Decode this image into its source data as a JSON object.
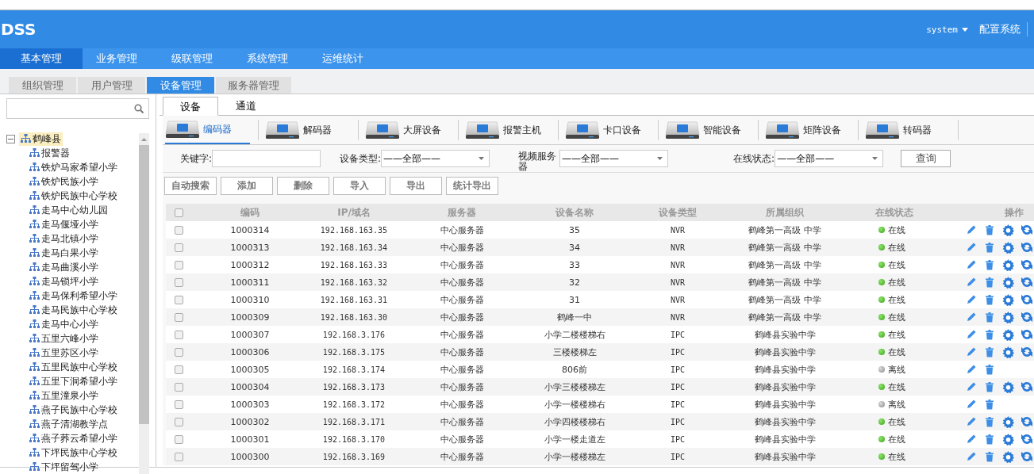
{
  "header": {
    "logo": "DSS",
    "user": "system",
    "config": "配置系统"
  },
  "nav": [
    {
      "label": "基本管理",
      "selected": true
    },
    {
      "label": "业务管理",
      "selected": false
    },
    {
      "label": "级联管理",
      "selected": false
    },
    {
      "label": "系统管理",
      "selected": false
    },
    {
      "label": "运维统计",
      "selected": false
    }
  ],
  "subtabs": [
    {
      "label": "组织管理",
      "selected": false
    },
    {
      "label": "用户管理",
      "selected": false
    },
    {
      "label": "设备管理",
      "selected": true
    },
    {
      "label": "服务器管理",
      "selected": false
    }
  ],
  "tree": {
    "label": "鹤峰县",
    "expanded": true,
    "selected": true,
    "children": [
      {
        "label": "报警器"
      },
      {
        "label": "铁炉马家希望小学"
      },
      {
        "label": "铁炉民族小学"
      },
      {
        "label": "铁炉民族中心学校"
      },
      {
        "label": "走马中心幼儿园"
      },
      {
        "label": "走马偃垭小学"
      },
      {
        "label": "走马北镇小学"
      },
      {
        "label": "走马白果小学"
      },
      {
        "label": "走马曲溪小学"
      },
      {
        "label": "走马锁坪小学"
      },
      {
        "label": "走马保利希望小学"
      },
      {
        "label": "走马民族中心学校"
      },
      {
        "label": "走马中心小学"
      },
      {
        "label": "五里六峰小学"
      },
      {
        "label": "五里苏区小学"
      },
      {
        "label": "五里民族中心学校"
      },
      {
        "label": "五里下洞希望小学"
      },
      {
        "label": "五里潼泉小学"
      },
      {
        "label": "燕子民族中心学校"
      },
      {
        "label": "燕子清湖教学点"
      },
      {
        "label": "燕子荞云希望小学"
      },
      {
        "label": "下坪民族中心学校"
      },
      {
        "label": "下坪留驾小学"
      }
    ]
  },
  "tabs": [
    {
      "label": "设备",
      "selected": true
    },
    {
      "label": "通道",
      "selected": false
    }
  ],
  "device_types": [
    {
      "label": "编码器",
      "selected": true
    },
    {
      "label": "解码器",
      "selected": false
    },
    {
      "label": "大屏设备",
      "selected": false
    },
    {
      "label": "报警主机",
      "selected": false
    },
    {
      "label": "卡口设备",
      "selected": false
    },
    {
      "label": "智能设备",
      "selected": false
    },
    {
      "label": "矩阵设备",
      "selected": false
    },
    {
      "label": "转码器",
      "selected": false
    }
  ],
  "filters": {
    "keyword_label": "关键字:",
    "type_label": "设备类型:",
    "type_value": "——全部——",
    "server_label": "视频服务器",
    "server_value": "——全部——",
    "status_label": "在线状态:",
    "status_value": "——全部——",
    "query": "查询"
  },
  "actions": [
    "自动搜索",
    "添加",
    "删除",
    "导入",
    "导出",
    "统计导出"
  ],
  "table": {
    "header_checked": false,
    "columns": [
      "编码",
      "IP/域名",
      "服务器",
      "设备名称",
      "设备类型",
      "所属组织",
      "在线状态",
      "操作"
    ],
    "rows": [
      {
        "code": "1000314",
        "ip": "192.168.163.35",
        "server": "中心服务器",
        "name": "35",
        "type": "NVR",
        "org": "鹤峰第一高级 中学",
        "status": "在线",
        "online": true,
        "checked": false
      },
      {
        "code": "1000313",
        "ip": "192.168.163.34",
        "server": "中心服务器",
        "name": "34",
        "type": "NVR",
        "org": "鹤峰第一高级 中学",
        "status": "在线",
        "online": true,
        "checked": false
      },
      {
        "code": "1000312",
        "ip": "192.168.163.33",
        "server": "中心服务器",
        "name": "33",
        "type": "NVR",
        "org": "鹤峰第一高级 中学",
        "status": "在线",
        "online": true,
        "checked": false
      },
      {
        "code": "1000311",
        "ip": "192.168.163.32",
        "server": "中心服务器",
        "name": "32",
        "type": "NVR",
        "org": "鹤峰第一高级 中学",
        "status": "在线",
        "online": true,
        "checked": false
      },
      {
        "code": "1000310",
        "ip": "192.168.163.31",
        "server": "中心服务器",
        "name": "31",
        "type": "NVR",
        "org": "鹤峰第一高级 中学",
        "status": "在线",
        "online": true,
        "checked": false
      },
      {
        "code": "1000309",
        "ip": "192.168.163.30",
        "server": "中心服务器",
        "name": "鹤峰一中",
        "type": "NVR",
        "org": "鹤峰第一高级 中学",
        "status": "在线",
        "online": true,
        "checked": false
      },
      {
        "code": "1000307",
        "ip": "192.168.3.176",
        "server": "中心服务器",
        "name": "小学二楼楼梯右",
        "type": "IPC",
        "org": "鹤峰县实验中学",
        "status": "在线",
        "online": true,
        "checked": false
      },
      {
        "code": "1000306",
        "ip": "192.168.3.175",
        "server": "中心服务器",
        "name": "三楼楼梯左",
        "type": "IPC",
        "org": "鹤峰县实验中学",
        "status": "在线",
        "online": true,
        "checked": false
      },
      {
        "code": "1000305",
        "ip": "192.168.3.174",
        "server": "中心服务器",
        "name": "806前",
        "type": "IPC",
        "org": "鹤峰县实验中学",
        "status": "离线",
        "online": false,
        "checked": false
      },
      {
        "code": "1000304",
        "ip": "192.168.3.173",
        "server": "中心服务器",
        "name": "小学三楼楼梯左",
        "type": "IPC",
        "org": "鹤峰县实验中学",
        "status": "在线",
        "online": true,
        "checked": false
      },
      {
        "code": "1000303",
        "ip": "192.168.3.172",
        "server": "中心服务器",
        "name": "小学一楼楼梯右",
        "type": "IPC",
        "org": "鹤峰县实验中学",
        "status": "离线",
        "online": false,
        "checked": false
      },
      {
        "code": "1000302",
        "ip": "192.168.3.171",
        "server": "中心服务器",
        "name": "小学四楼楼梯右",
        "type": "IPC",
        "org": "鹤峰县实验中学",
        "status": "在线",
        "online": true,
        "checked": false
      },
      {
        "code": "1000301",
        "ip": "192.168.3.170",
        "server": "中心服务器",
        "name": "小学一楼走道左",
        "type": "IPC",
        "org": "鹤峰县实验中学",
        "status": "在线",
        "online": true,
        "checked": false
      },
      {
        "code": "1000300",
        "ip": "192.168.3.169",
        "server": "中心服务器",
        "name": "小学一楼楼梯左",
        "type": "IPC",
        "org": "鹤峰县实验中学",
        "status": "在线",
        "online": true,
        "checked": false
      }
    ]
  }
}
